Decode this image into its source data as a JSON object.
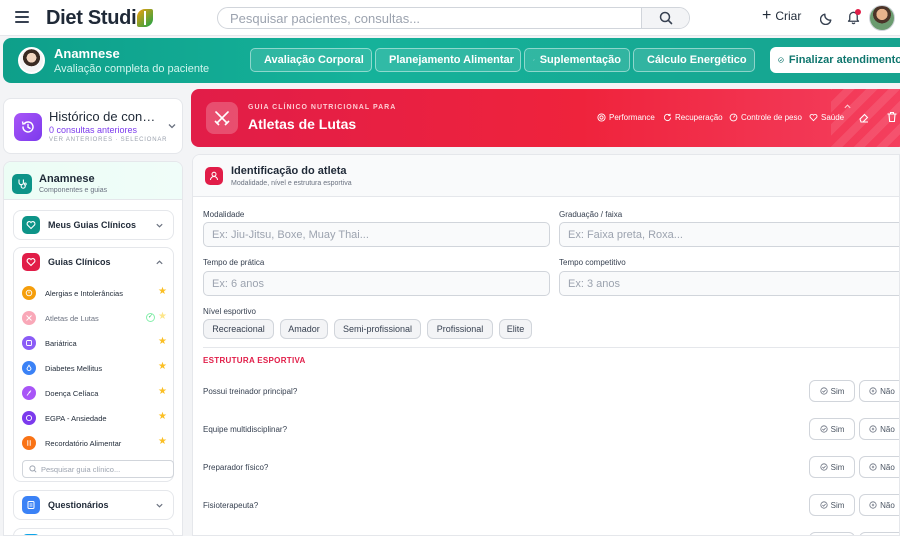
{
  "topbar": {
    "logo_text": "Diet Studi",
    "search_placeholder": "Pesquisar pacientes, consultas...",
    "create_label": "Criar"
  },
  "patient_bar": {
    "title": "Anamnese",
    "subtitle": "Avaliação completa do paciente",
    "buttons": [
      {
        "label": "Avaliação Corporal",
        "icon": "pulse-icon"
      },
      {
        "label": "Planejamento Alimentar",
        "icon": "clipboard-icon"
      },
      {
        "label": "Suplementação",
        "icon": "pill-icon"
      },
      {
        "label": "Cálculo Energético",
        "icon": "calculator-icon"
      }
    ],
    "finish_label": "Finalizar atendimento"
  },
  "history": {
    "title": "Histórico de consultas",
    "count": "0 consultas anteriores",
    "link": "VER ANTERIORES · SELECIONAR"
  },
  "anamnese_panel": {
    "title": "Anamnese",
    "subtitle": "Componentes e guias",
    "sections": {
      "my_guides": "Meus Guias Clínicos",
      "clinical_guides": "Guias Clínicos",
      "questionnaires": "Questionários"
    },
    "guides": [
      {
        "label": "Alergias e Intolerâncias",
        "color": "#f59e0b",
        "favorite": true
      },
      {
        "label": "Atletas de Lutas",
        "color": "#f9a8b8",
        "favorite": true,
        "active": true
      },
      {
        "label": "Bariátrica",
        "color": "#8b5cf6",
        "favorite": true
      },
      {
        "label": "Diabetes Mellitus",
        "color": "#3b82f6",
        "favorite": true
      },
      {
        "label": "Doença Celíaca",
        "color": "#a855f7",
        "favorite": true
      },
      {
        "label": "EGPA - Ansiedade",
        "color": "#7c3aed",
        "favorite": true
      },
      {
        "label": "Recordatório Alimentar",
        "color": "#f97316",
        "favorite": true
      }
    ],
    "guide_search_placeholder": "Pesquisar guia clínico..."
  },
  "guide_header": {
    "overline": "GUIA CLÍNICO NUTRICIONAL PARA",
    "title": "Atletas de Lutas",
    "tags": [
      {
        "label": "Performance",
        "icon": "target-icon"
      },
      {
        "label": "Recuperação",
        "icon": "refresh-icon"
      },
      {
        "label": "Controle de peso",
        "icon": "scale-icon"
      },
      {
        "label": "Saúde",
        "icon": "heart-icon"
      }
    ]
  },
  "identification": {
    "title": "Identificação do atleta",
    "subtitle": "Modalidade, nível e estrutura esportiva",
    "fields": [
      {
        "label": "Modalidade",
        "placeholder": "Ex: Jiu-Jitsu, Boxe, Muay Thai..."
      },
      {
        "label": "Graduação / faixa",
        "placeholder": "Ex: Faixa preta, Roxa..."
      },
      {
        "label": "Tempo de prática",
        "placeholder": "Ex: 6 anos"
      },
      {
        "label": "Tempo competitivo",
        "placeholder": "Ex: 3 anos"
      }
    ],
    "level_label": "Nível esportivo",
    "levels": [
      "Recreacional",
      "Amador",
      "Semi-profissional",
      "Profissional",
      "Elite"
    ]
  },
  "structure": {
    "title": "ESTRUTURA ESPORTIVA",
    "yes_label": "Sim",
    "no_label": "Não",
    "questions": [
      "Possui treinador principal?",
      "Equipe multidisciplinar?",
      "Preparador físico?",
      "Fisioterapeuta?"
    ]
  },
  "colors": {
    "teal": "#0e9f8a",
    "red": "#e11d48",
    "purple": "#7c3aed",
    "star": "#fbbf24"
  }
}
